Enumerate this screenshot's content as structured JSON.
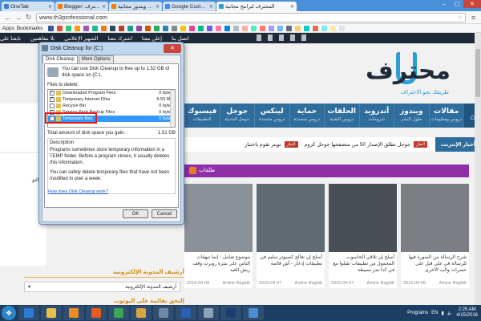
{
  "browser": {
    "tabs": [
      {
        "label": "OneTab",
        "color": "#3b7dd8"
      },
      {
        "label": "Blogger: موقع المحترف",
        "color": "#f57d00"
      },
      {
        "label": "ملصقات ويندوز مجانية",
        "color": "#f57d00"
      },
      {
        "label": "Google Custom Search",
        "color": "#4285f4"
      },
      {
        "label": "المحترف لبرامج مجانية",
        "color": "#2a9fd6",
        "active": true
      }
    ],
    "url": "www.th3professional.com",
    "bookmarks_labels": [
      "Apps",
      "Bookmarks"
    ]
  },
  "site": {
    "topbar": [
      "اتصل بنا",
      "إعلن معنا",
      "اشترك معنا",
      "الشهير الإعلامي",
      "بلا مقاهمين",
      "تابعنا على"
    ],
    "logo": {
      "text": "محترف",
      "tagline": "طريقك نحو الاحتراف"
    },
    "nav": [
      {
        "title": "مقالات",
        "sub": "دروس ومعلومات"
      },
      {
        "title": "ويندوز",
        "sub": "حلول النشر"
      },
      {
        "title": "أندرويد",
        "sub": "شروحات"
      },
      {
        "title": "الحلقات",
        "sub": "دروس التقنية"
      },
      {
        "title": "حماية",
        "sub": "دروس متجددة"
      },
      {
        "title": "لينكس",
        "sub": "دروس متجددة"
      },
      {
        "title": "جوجل",
        "sub": "جوجل الحديثة"
      },
      {
        "title": "فيسبوك",
        "sub": "التطبيقات"
      }
    ],
    "ticker": {
      "label": "أخبار الإنترنت",
      "items": [
        {
          "badge": "أخبار",
          "text": "جوجل تطلق الإصدار 50 من متصفحها جوجل كروم"
        },
        {
          "badge": "أخبار",
          "text": "تويتر تقوم باختبار"
        }
      ]
    },
    "section": {
      "label": "طلقات"
    },
    "cards": [
      {
        "title": "موضوع شامل - إنما تنهقات الناس على نيثرة روبرت وقف ريش العيد",
        "author": "Amine Raghib",
        "date": "2016-04-08",
        "color": "#8a9198"
      },
      {
        "title": "أصلح إن تعالج كمبيوتر سليم في تطبيقات إدخار - آش قائمة",
        "author": "Amine Raghib",
        "date": "2016-04-07",
        "color": "#5f6a73"
      },
      {
        "title": "أصلح إن تلاقي الحاسوب المحمول من تطبيقات تقبلوا مع في كذا تمر بسيطة",
        "author": "Amine Raghib",
        "date": "2016-04-07",
        "color": "#4a4f55"
      },
      {
        "title": "شرح الرسالة من الصورة فيها للرسالة في على قبل على حصرات والب الأخرى",
        "author": "Amine Raghib",
        "date": "2016-04-05",
        "color": "#7b7f84"
      }
    ],
    "sidebar": {
      "archive_heading": "أرشيف المدونة الإلكترونية",
      "archive_select": "أرشيف المدونة الإلكترونية",
      "follow_heading": "إلتحق بقائمة على اليوتوب"
    },
    "left_text": "كيف التو"
  },
  "dialog": {
    "title": "Disk Cleanup for  (C:)",
    "tabs": [
      "Disk Cleanup",
      "More Options"
    ],
    "intro": "You can use Disk Cleanup to free up to 1.52 GB of disk space on  (C:).",
    "files_label": "Files to delete:",
    "files": [
      {
        "name": "Downloaded Program Files",
        "size": "0 bytes",
        "checked": true
      },
      {
        "name": "Temporary Internet Files",
        "size": "6.53 MB",
        "checked": true
      },
      {
        "name": "Recycle Bin",
        "size": "0 bytes",
        "checked": false
      },
      {
        "name": "Service Pack Backup Files",
        "size": "0 bytes",
        "checked": true
      },
      {
        "name": "Temporary files",
        "size": "0 bytes",
        "checked": true,
        "selected": true
      }
    ],
    "total_label": "Total amount of disk space you gain:",
    "total_value": "1.51 GB",
    "description_title": "Description",
    "description_1": "Programs sometimes store temporary information in a TEMP folder. Before a program closes, it usually deletes this information.",
    "description_2": "You can safely delete temporary files that have not been modified in over a week.",
    "link": "How does Disk Cleanup work?",
    "ok": "OK",
    "cancel": "Cancel"
  },
  "taskbar": {
    "apps": [
      {
        "name": "ie-icon",
        "color": "#2b7cd3"
      },
      {
        "name": "folder-icon",
        "color": "#e8c04a"
      },
      {
        "name": "media-player-icon",
        "color": "#f08b24"
      },
      {
        "name": "firefox-icon",
        "color": "#e65c1f"
      },
      {
        "name": "chrome-icon",
        "color": "#3aa757"
      },
      {
        "name": "paint-icon",
        "color": "#d9a441"
      },
      {
        "name": "calculator-icon",
        "color": "#6f8aa6"
      },
      {
        "name": "word-icon",
        "color": "#2b5fb8"
      },
      {
        "name": "disk-cleanup-icon",
        "color": "#8fa3b8"
      },
      {
        "name": "photoshop-icon",
        "color": "#1b3e72"
      },
      {
        "name": "media-icon",
        "color": "#4b8fd1"
      }
    ],
    "programs": "Programs",
    "lang": "EN",
    "time": "2:25 AM",
    "date": "4/15/2016"
  }
}
